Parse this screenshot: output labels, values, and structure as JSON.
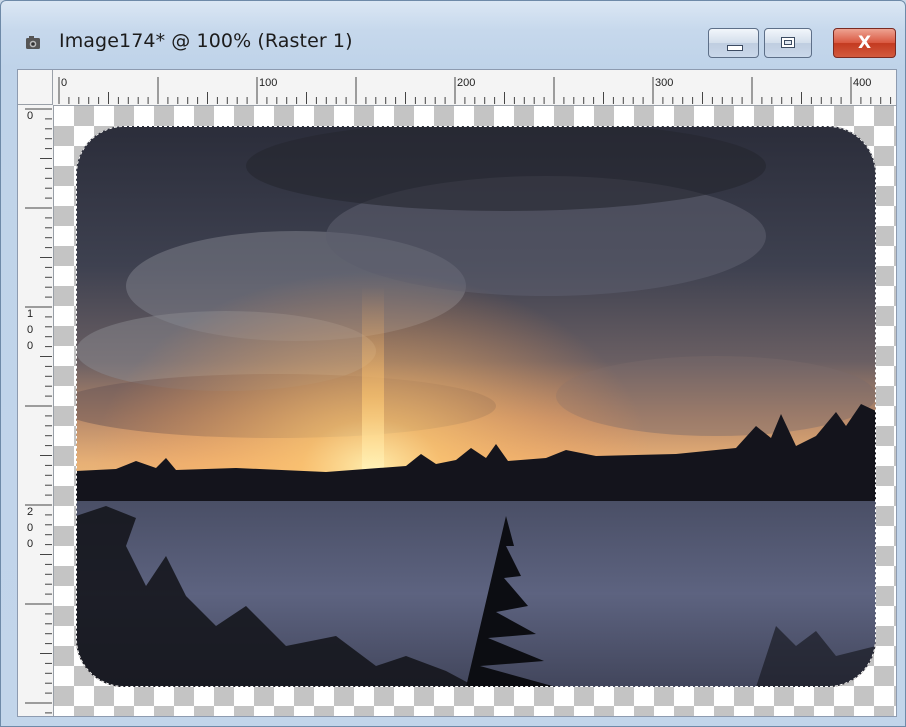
{
  "window": {
    "title": "Image174* @ 100% (Raster 1)",
    "icons": {
      "app": "camera-icon",
      "minimize": "minimize-icon",
      "maximize": "maximize-icon",
      "close": "close-icon"
    },
    "close_glyph": "X"
  },
  "rulers": {
    "horizontal_labels": [
      "0",
      "100",
      "200",
      "300",
      "400"
    ],
    "vertical_labels": [
      {
        "digits": [
          "0"
        ]
      },
      {
        "digits": [
          "1",
          "0",
          "0"
        ]
      },
      {
        "digits": [
          "2",
          "0",
          "0"
        ]
      }
    ]
  },
  "canvas": {
    "transparency": "checkerboard",
    "selection": "rounded-rectangle-marquee",
    "photo": "snowy field sunset with sun pillar"
  },
  "colors": {
    "close_button": "#d04a30",
    "title_bar": "#c6d8ec",
    "checker_dark": "#c4c4c4",
    "checker_light": "#ffffff"
  }
}
